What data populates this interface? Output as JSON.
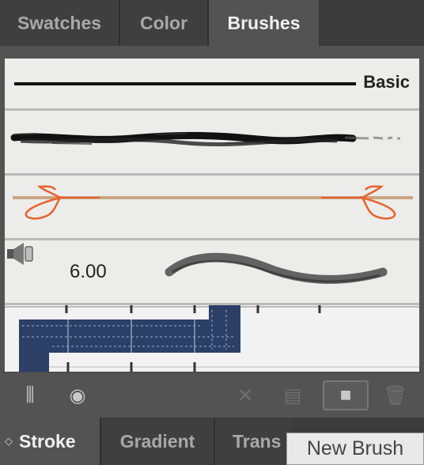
{
  "top_tabs": [
    {
      "label": "Swatches"
    },
    {
      "label": "Color"
    },
    {
      "label": "Brushes"
    }
  ],
  "active_tab": "Brushes",
  "brushes": {
    "basic": {
      "label": "Basic"
    },
    "bristle": {
      "size_value": "6.00"
    }
  },
  "toolbar": {
    "library_icon": "brush-libraries-icon",
    "library_glyph": "⫼",
    "libpanel_icon": "libraries-panel-icon",
    "libpanel_glyph": "◉",
    "remove_icon": "remove-stroke-icon",
    "remove_glyph": "✕",
    "options_icon": "brush-options-icon",
    "options_glyph": "▤",
    "new_icon": "new-brush-icon",
    "new_glyph": "■",
    "delete_icon": "trash-icon",
    "delete_glyph": "🗑"
  },
  "bottom_tabs": [
    {
      "label": "Stroke"
    },
    {
      "label": "Gradient"
    },
    {
      "label": "Trans"
    }
  ],
  "tooltip": {
    "text": "New Brush"
  },
  "colors": {
    "panel_bg": "#535353",
    "tab_active": "#535353",
    "tab_inactive": "#3f3f3f",
    "list_bg": "#ececeb",
    "accent_orange": "#e8622c",
    "chalk_blue": "#2c3f67"
  }
}
